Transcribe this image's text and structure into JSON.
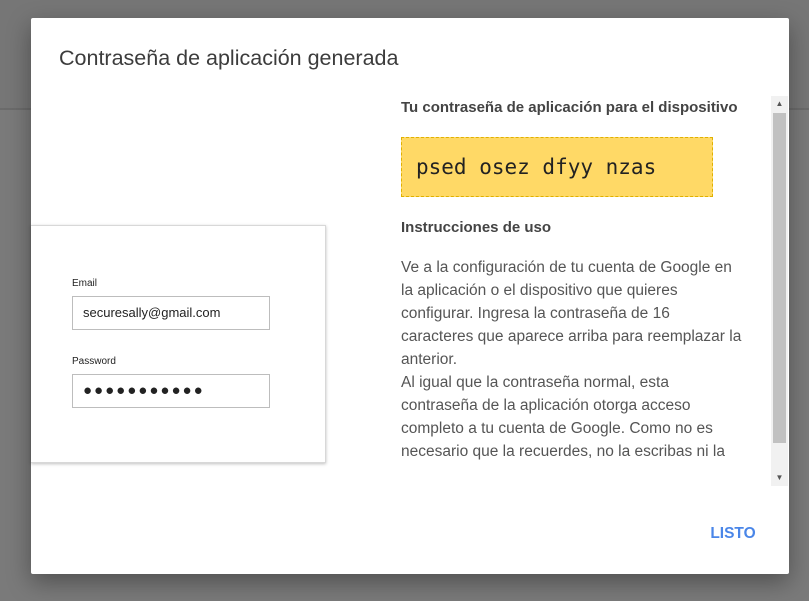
{
  "dialog": {
    "title": "Contraseña de aplicación generada",
    "done_label": "LISTO"
  },
  "illustration": {
    "email_label": "Email",
    "email_value": "securesally@gmail.com",
    "password_label": "Password",
    "password_value": "●●●●●●●●●●●"
  },
  "content": {
    "subhead": "Tu contraseña de aplicación para el dispositivo",
    "app_password": "psed osez dfyy nzas",
    "instructions_title": "Instrucciones de uso",
    "instructions_p1": "Ve a la configuración de tu cuenta de Google en la aplicación o el dispositivo que quieres configurar. Ingresa la contraseña de 16 caracteres que aparece arriba para reemplazar la anterior.",
    "instructions_p2": "Al igual que la contraseña normal, esta contraseña de la aplicación otorga acceso completo a tu cuenta de Google. Como no es necesario que la recuerdes, no la escribas ni la"
  },
  "scrollbar": {
    "up_icon": "▲",
    "down_icon": "▼"
  },
  "colors": {
    "password_highlight": "#ffd966",
    "accent": "#4a86e8"
  }
}
